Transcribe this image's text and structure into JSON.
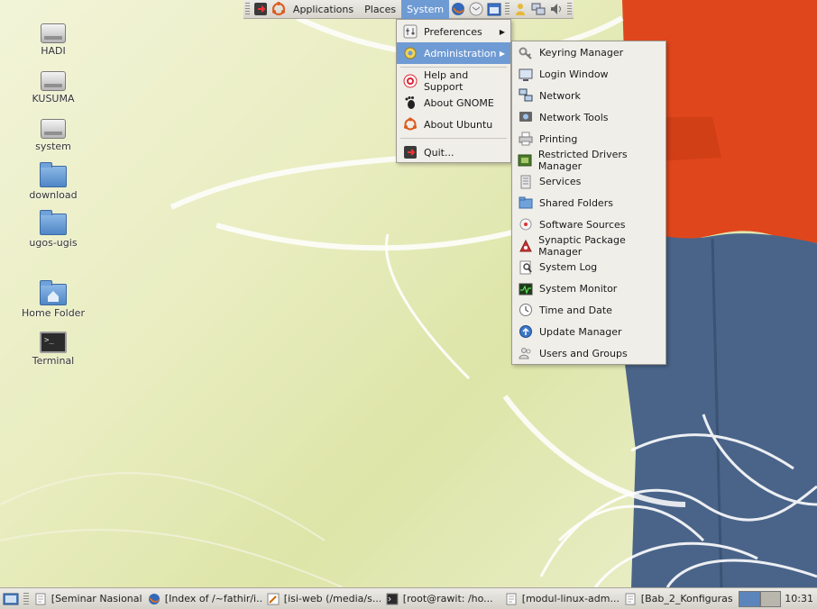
{
  "top_panel": {
    "menus": [
      {
        "label": "Applications"
      },
      {
        "label": "Places"
      },
      {
        "label": "System",
        "active": true
      }
    ]
  },
  "desktop_icons": [
    {
      "label": "HADI",
      "icon": "drive-icon"
    },
    {
      "label": "KUSUMA",
      "icon": "drive-icon"
    },
    {
      "label": "system",
      "icon": "drive-icon"
    },
    {
      "label": "download",
      "icon": "folder-icon"
    },
    {
      "label": "ugos-ugis",
      "icon": "folder-icon"
    },
    {
      "label": "Home Folder",
      "icon": "home-folder-icon"
    },
    {
      "label": "Terminal",
      "icon": "terminal-icon"
    }
  ],
  "system_menu": {
    "items": [
      {
        "label": "Preferences",
        "icon": "preferences-icon",
        "submenu": true
      },
      {
        "label": "Administration",
        "icon": "administration-icon",
        "submenu": true,
        "highlighted": true
      },
      {
        "label": "Help and Support",
        "icon": "help-icon"
      },
      {
        "label": "About GNOME",
        "icon": "gnome-foot-icon"
      },
      {
        "label": "About Ubuntu",
        "icon": "ubuntu-icon"
      },
      {
        "label": "Quit...",
        "icon": "quit-icon"
      }
    ]
  },
  "admin_menu": {
    "items": [
      {
        "label": "Keyring Manager",
        "icon": "keyring-icon"
      },
      {
        "label": "Login Window",
        "icon": "login-window-icon"
      },
      {
        "label": "Network",
        "icon": "network-icon"
      },
      {
        "label": "Network Tools",
        "icon": "network-tools-icon"
      },
      {
        "label": "Printing",
        "icon": "printer-icon"
      },
      {
        "label": "Restricted Drivers Manager",
        "icon": "chip-icon"
      },
      {
        "label": "Services",
        "icon": "services-icon"
      },
      {
        "label": "Shared Folders",
        "icon": "shared-folder-icon"
      },
      {
        "label": "Software Sources",
        "icon": "software-sources-icon"
      },
      {
        "label": "Synaptic Package Manager",
        "icon": "synaptic-icon"
      },
      {
        "label": "System Log",
        "icon": "system-log-icon"
      },
      {
        "label": "System Monitor",
        "icon": "system-monitor-icon"
      },
      {
        "label": "Time and Date",
        "icon": "clock-icon"
      },
      {
        "label": "Update Manager",
        "icon": "update-icon"
      },
      {
        "label": "Users and Groups",
        "icon": "users-icon"
      }
    ]
  },
  "taskbar": {
    "tasks": [
      {
        "label": "[Seminar Nasional...",
        "icon": "document-icon"
      },
      {
        "label": "[Index of /~fathir/i...",
        "icon": "firefox-icon"
      },
      {
        "label": "[isi-web (/media/s...",
        "icon": "editor-icon"
      },
      {
        "label": "[root@rawit: /ho...",
        "icon": "terminal-icon"
      },
      {
        "label": "[modul-linux-adm...",
        "icon": "document-icon"
      },
      {
        "label": "[Bab_2_Konfiguras...",
        "icon": "document-icon"
      }
    ],
    "clock": "10:31"
  },
  "colors": {
    "highlight": "#6f9bd4",
    "panel": "#e3e1da",
    "wallpaper_jacket": "#e0461c",
    "wallpaper_jeans": "#4a6489"
  }
}
